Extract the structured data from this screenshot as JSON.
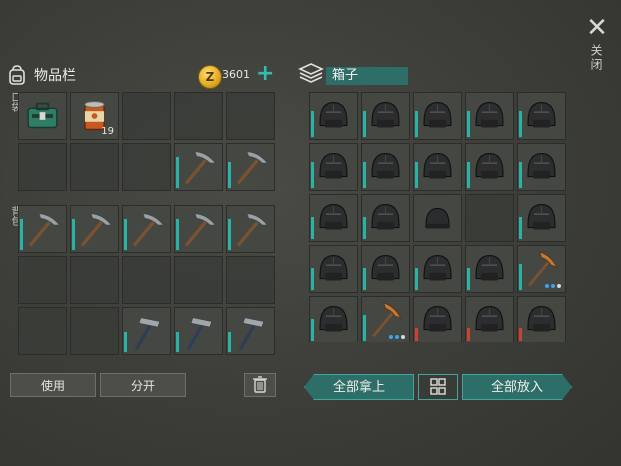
{
  "inventory": {
    "title": "物品栏",
    "coins": "3601",
    "pocket_label": "口袋",
    "backpack_label": "背包"
  },
  "pocket": [
    {
      "item": "medkit"
    },
    {
      "item": "can",
      "qty": "19"
    },
    {
      "item": ""
    },
    {
      "item": ""
    },
    {
      "item": ""
    },
    {
      "item": ""
    },
    {
      "item": ""
    },
    {
      "item": ""
    },
    {
      "item": "pickaxe",
      "level": 0.7
    },
    {
      "item": "pickaxe",
      "level": 0.6
    }
  ],
  "backpack": [
    {
      "item": "pickaxe",
      "level": 0.7
    },
    {
      "item": "pickaxe",
      "level": 0.7
    },
    {
      "item": "pickaxe",
      "level": 0.7
    },
    {
      "item": "pickaxe",
      "level": 0.7
    },
    {
      "item": "pickaxe",
      "level": 0.7
    },
    {
      "item": ""
    },
    {
      "item": ""
    },
    {
      "item": ""
    },
    {
      "item": ""
    },
    {
      "item": ""
    },
    {
      "item": ""
    },
    {
      "item": ""
    },
    {
      "item": "hammer",
      "level": 0.45
    },
    {
      "item": "hammer",
      "level": 0.45
    },
    {
      "item": "hammer",
      "level": 0.45
    }
  ],
  "chest": {
    "title": "箱子",
    "slots": [
      {
        "item": "helmet",
        "level": 0.6
      },
      {
        "item": "helmet",
        "level": 0.6
      },
      {
        "item": "helmet",
        "level": 0.6
      },
      {
        "item": "helmet",
        "level": 0.6
      },
      {
        "item": "helmet",
        "level": 0.6
      },
      {
        "item": "helmet",
        "level": 0.6
      },
      {
        "item": "helmet",
        "level": 0.6
      },
      {
        "item": "helmet",
        "level": 0.6
      },
      {
        "item": "helmet",
        "level": 0.6
      },
      {
        "item": "helmet",
        "level": 0.6
      },
      {
        "item": "helmet",
        "level": 0.5
      },
      {
        "item": "helmet",
        "level": 0.5
      },
      {
        "item": "beanie"
      },
      {
        "item": ""
      },
      {
        "item": "helmet",
        "level": 0.5
      },
      {
        "item": "helmet",
        "level": 0.5
      },
      {
        "item": "helmet",
        "level": 0.5
      },
      {
        "item": "helmet",
        "level": 0.5
      },
      {
        "item": "helmet",
        "level": 0.5
      },
      {
        "item": "copper-pickaxe",
        "level": 0.6,
        "dots": true
      },
      {
        "item": "helmet",
        "level": 0.5
      },
      {
        "item": "copper-pickaxe",
        "level": 0.6,
        "dots": true
      },
      {
        "item": "helmet",
        "level": 0.3,
        "red": true
      },
      {
        "item": "helmet",
        "level": 0.3,
        "red": true
      },
      {
        "item": "helmet",
        "level": 0.3,
        "red": true
      }
    ]
  },
  "buttons": {
    "use": "使用",
    "split": "分开",
    "take_all": "全部拿上",
    "put_all": "全部放入",
    "close": "关闭"
  },
  "colors": {
    "accent": "#2e6e68",
    "durability": "#28b3a6",
    "low": "#d0402f"
  }
}
